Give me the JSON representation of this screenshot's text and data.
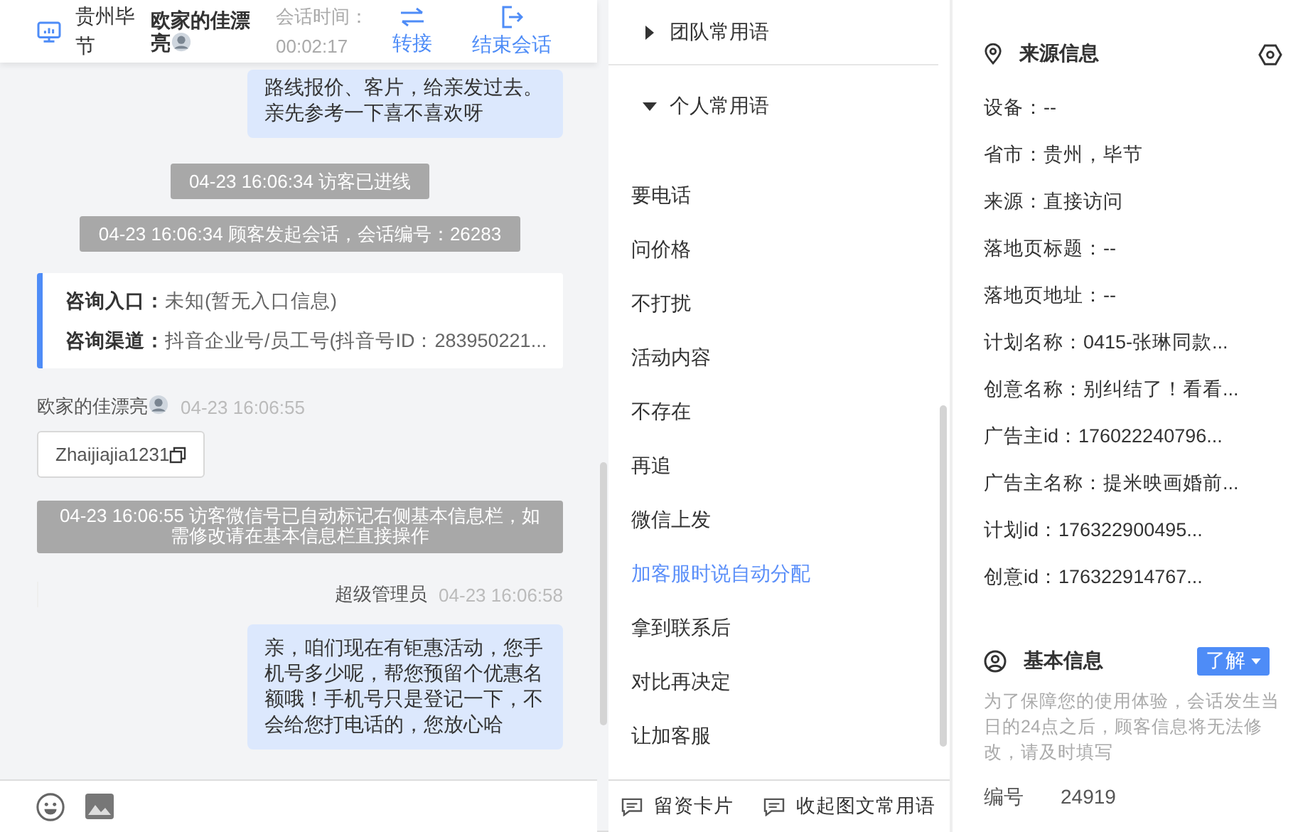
{
  "header": {
    "location": "贵州毕节",
    "customer_name": "欧家的佳漂亮",
    "session_time_label": "会话时间：",
    "session_time": "00:02:17",
    "actions": [
      {
        "kind": "transfer",
        "label": "转接"
      },
      {
        "kind": "end",
        "label": "结束会话"
      }
    ]
  },
  "messages": [
    {
      "kind": "agent_text",
      "text": "路线报价、客片，给亲发过去。亲先参考一下喜不喜欢呀"
    },
    {
      "kind": "notice",
      "text": "04-23 16:06:34 访客已进线"
    },
    {
      "kind": "notice",
      "text": "04-23 16:06:34 顾客发起会话，会话编号：26283"
    },
    {
      "kind": "info_card",
      "rows": [
        {
          "label": "咨询入口：",
          "value": "未知(暂无入口信息)"
        },
        {
          "label": "咨询渠道：",
          "value": "抖音企业号/员工号(抖音号ID：283950221..."
        }
      ]
    },
    {
      "kind": "visitor_header",
      "name": "欧家的佳漂亮",
      "time": "04-23 16:06:55"
    },
    {
      "kind": "copy_card",
      "text": "Zhaijiajia1231"
    },
    {
      "kind": "notice",
      "text": "04-23 16:06:55 访客微信号已自动标记右侧基本信息栏，如需修改请在基本信息栏直接操作"
    },
    {
      "kind": "agent_header",
      "name": "超级管理员",
      "time": "04-23 16:06:58"
    },
    {
      "kind": "agent_text",
      "text": "亲，咱们现在有钜惠活动，您手机号多少呢，帮您预留个优惠名额哦！手机号只是登记一下，不会给您打电话的，您放心哈"
    }
  ],
  "composer_tools": [
    {
      "kind": "emoji"
    },
    {
      "kind": "image"
    }
  ],
  "phrase_groups": [
    {
      "title": "团队常用语",
      "expanded": false
    },
    {
      "title": "个人常用语",
      "expanded": true,
      "items": [
        {
          "text": "要电话",
          "selected": false
        },
        {
          "text": "问价格",
          "selected": false
        },
        {
          "text": "不打扰",
          "selected": false
        },
        {
          "text": "活动内容",
          "selected": false
        },
        {
          "text": "不存在",
          "selected": false
        },
        {
          "text": "再追",
          "selected": false
        },
        {
          "text": "微信上发",
          "selected": false
        },
        {
          "text": "加客服时说自动分配",
          "selected": true
        },
        {
          "text": "拿到联系后",
          "selected": false
        },
        {
          "text": "对比再决定",
          "selected": false
        },
        {
          "text": "让加客服",
          "selected": false
        }
      ]
    }
  ],
  "phrase_actions": [
    "留资卡片",
    "收起图文常用语"
  ],
  "source_info": {
    "title": "来源信息",
    "fields": [
      "设备：--",
      "省市：贵州，毕节",
      "来源：直接访问",
      "落地页标题：--",
      "落地页地址：--",
      "计划名称：0415-张琳同款...",
      "创意名称：别纠结了！看看...",
      "广告主id：176022240796...",
      "广告主名称：提米映画婚前...",
      "计划id：176322900495...",
      "创意id：176322914767..."
    ]
  },
  "basic_info": {
    "title": "基本信息",
    "help_button": "了解",
    "notice": "为了保障您的使用体验，会话发生当日的24点之后，顾客信息将无法修改，请及时填写",
    "fields": [
      {
        "label": "编号",
        "value": "24919"
      }
    ]
  }
}
